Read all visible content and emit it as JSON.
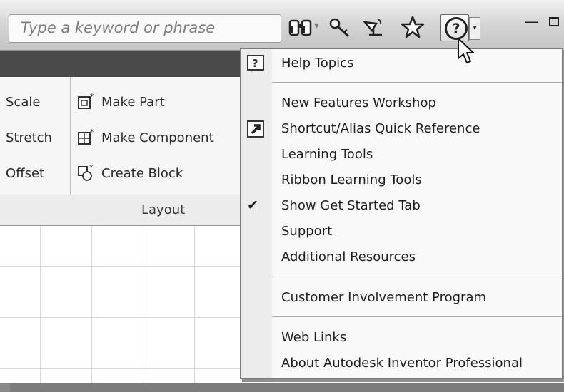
{
  "search": {
    "placeholder": "Type a keyword or phrase"
  },
  "toolbar": {
    "icons": [
      "binoculars-icon",
      "key-icon",
      "satellite-icon",
      "star-icon",
      "help-icon"
    ]
  },
  "ribbon": {
    "modify_items": [
      "Scale",
      "Stretch",
      "Offset"
    ],
    "layout_items": [
      {
        "label": "Make Part",
        "icon": "make-part-icon"
      },
      {
        "label": "Make Component",
        "icon": "make-component-icon"
      },
      {
        "label": "Create Block",
        "icon": "create-block-icon"
      }
    ],
    "layout_panel_label": "Layout"
  },
  "help_menu": {
    "items": [
      {
        "label": "Help Topics",
        "icon": "help-topics-icon"
      },
      {
        "label": "New Features Workshop"
      },
      {
        "label": "Shortcut/Alias Quick Reference",
        "icon": "shortcut-arrow-icon"
      },
      {
        "label": "Learning Tools"
      },
      {
        "label": "Ribbon Learning Tools"
      },
      {
        "label": "Show Get Started Tab",
        "checked": true
      },
      {
        "label": "Support"
      },
      {
        "label": "Additional Resources"
      },
      {
        "label": "Customer Involvement Program"
      },
      {
        "label": "Web Links"
      },
      {
        "label": "About Autodesk Inventor Professional"
      }
    ]
  }
}
